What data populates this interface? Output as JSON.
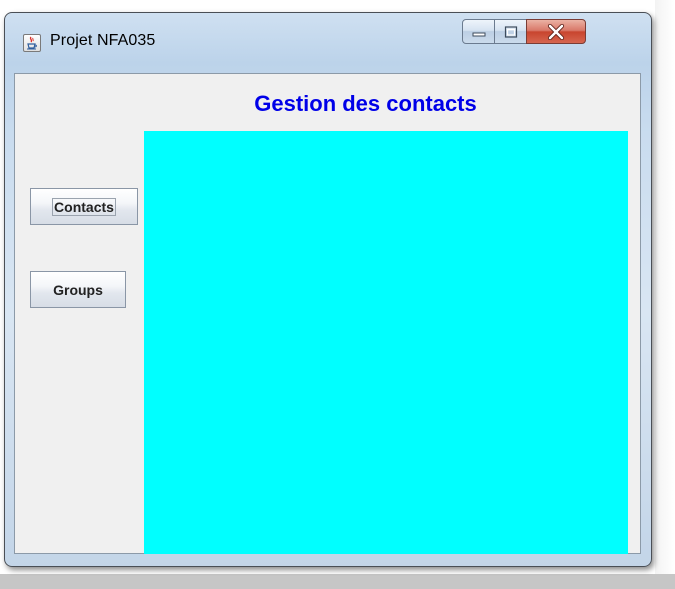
{
  "window": {
    "title": "Projet NFA035",
    "app_icon": "java-cup-icon",
    "controls": {
      "minimize_icon": "minimize-icon",
      "maximize_icon": "maximize-icon",
      "close_icon": "close-icon"
    }
  },
  "main": {
    "heading": "Gestion des contacts",
    "heading_color": "#0000e8",
    "panel_color": "#00ffff"
  },
  "sidebar": {
    "buttons": [
      {
        "label": "Contacts",
        "focused": true
      },
      {
        "label": "Groups",
        "focused": false
      }
    ]
  }
}
